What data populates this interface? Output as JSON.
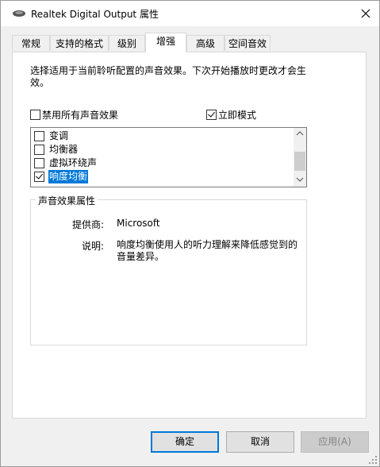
{
  "window": {
    "title": "Realtek Digital Output 属性"
  },
  "tabs": [
    {
      "label": "常规"
    },
    {
      "label": "支持的格式"
    },
    {
      "label": "级别"
    },
    {
      "label": "增强"
    },
    {
      "label": "高级"
    },
    {
      "label": "空间音效"
    }
  ],
  "active_tab": "增强",
  "enhancements": {
    "description": "选择适用于当前聆听配置的声音效果。下次开始播放时更改才会生效。",
    "disable_all": {
      "label": "禁用所有声音效果",
      "checked": false
    },
    "immediate_mode": {
      "label": "立即模式",
      "checked": true
    },
    "list": [
      {
        "label": "变调",
        "checked": false
      },
      {
        "label": "均衡器",
        "checked": false
      },
      {
        "label": "虚拟环绕声",
        "checked": false
      },
      {
        "label": "响度均衡",
        "checked": true,
        "selected": true
      }
    ]
  },
  "properties": {
    "group_title": "声音效果属性",
    "provider_label": "提供商:",
    "provider_value": "Microsoft",
    "description_label": "说明:",
    "description_value": "响度均衡使用人的听力理解来降低感觉到的音量差异。"
  },
  "buttons": {
    "ok": "确定",
    "cancel": "取消",
    "apply": "应用(A)"
  },
  "colors": {
    "accent": "#0078d7",
    "selection": "#0078d7"
  }
}
